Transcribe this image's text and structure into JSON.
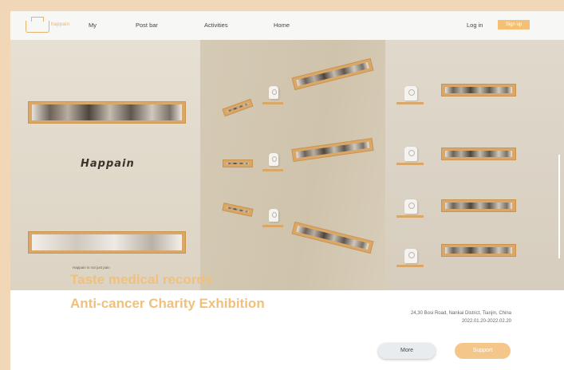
{
  "nav": {
    "logo_text": "happain",
    "links": [
      "My",
      "Post bar",
      "Activities",
      "Home"
    ],
    "login": "Log in",
    "signup": "Sign up"
  },
  "hero": {
    "word": "Happain",
    "caption": "Happain is not just pain"
  },
  "event": {
    "title_line1": "Taste medical records",
    "title_line2": "Anti-cancer Charity Exhibition",
    "address": "24,30 Bosi Road, Nankai District, Tianjin, China",
    "dates": "2022.01.20-2022.02.20"
  },
  "buttons": {
    "more": "More",
    "support": "Support"
  },
  "colors": {
    "accent": "#f1c07a",
    "background": "#f2d7b6"
  }
}
